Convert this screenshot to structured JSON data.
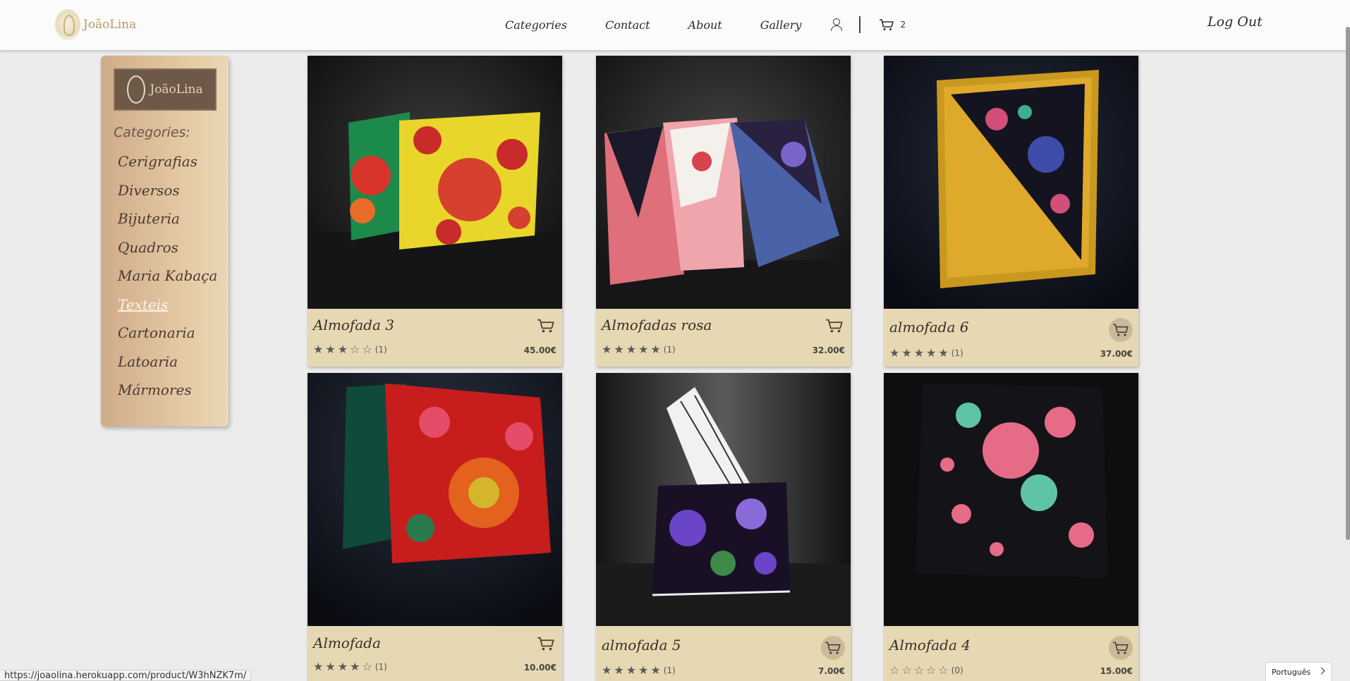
{
  "brand": {
    "name": "JoãoLina"
  },
  "nav": {
    "items": [
      "Categories",
      "Contact",
      "About",
      "Gallery"
    ],
    "cart_count": "2",
    "logout": "Log Out"
  },
  "sidebar": {
    "logo_text": "JoãoLina",
    "heading": "Categories:",
    "items": [
      {
        "label": "Cerigrafias",
        "active": false
      },
      {
        "label": "Diversos",
        "active": false
      },
      {
        "label": "Bijuteria",
        "active": false
      },
      {
        "label": "Quadros",
        "active": false
      },
      {
        "label": "Maria Kabaça",
        "active": false
      },
      {
        "label": "Texteis",
        "active": true
      },
      {
        "label": "Cartonaria",
        "active": false
      },
      {
        "label": "Latoaria",
        "active": false
      },
      {
        "label": "Mármores",
        "active": false
      }
    ]
  },
  "products": [
    {
      "title": "Almofada 3",
      "price": "45.00€",
      "rating": 3,
      "reviews": "(1)"
    },
    {
      "title": "Almofadas rosa",
      "price": "32.00€",
      "rating": 5,
      "reviews": "(1)"
    },
    {
      "title": "almofada 6",
      "price": "37.00€",
      "rating": 5,
      "reviews": "(1)"
    },
    {
      "title": "Almofada",
      "price": "10.00€",
      "rating": 4,
      "reviews": "(1)"
    },
    {
      "title": "almofada 5",
      "price": "7.00€",
      "rating": 5,
      "reviews": "(1)"
    },
    {
      "title": "Almofada 4",
      "price": "15.00€",
      "rating": 0,
      "reviews": "(0)"
    }
  ],
  "status_bar": {
    "url": "https://joaolina.herokuapp.com/product/W3hNZK7m/"
  },
  "language": {
    "label": "Português"
  },
  "colors": {
    "card_bg": "#e6d8b2",
    "sidebar_accent": "#d0ab8a",
    "page_bg": "#ececec"
  }
}
